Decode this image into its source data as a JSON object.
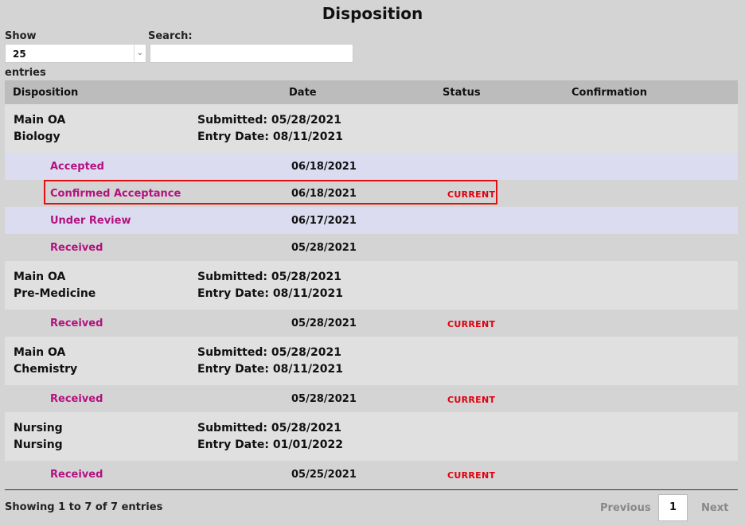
{
  "page": {
    "title": "Disposition"
  },
  "controls": {
    "show_label": "Show",
    "page_size": "25",
    "entries_label": "entries",
    "search_label": "Search:",
    "search_value": ""
  },
  "table": {
    "columns": [
      "Disposition",
      "Date",
      "Status",
      "Confirmation"
    ],
    "groups": [
      {
        "line1": "Main OA",
        "line2": "Biology",
        "submitted": "Submitted: 05/28/2021",
        "entry_date": "Entry Date: 08/11/2021",
        "rows": [
          {
            "name": "Accepted",
            "date": "06/18/2021",
            "status": ""
          },
          {
            "name": "Confirmed Acceptance",
            "date": "06/18/2021",
            "status": "CURRENT"
          },
          {
            "name": "Under Review",
            "date": "06/17/2021",
            "status": ""
          },
          {
            "name": "Received",
            "date": "05/28/2021",
            "status": ""
          }
        ]
      },
      {
        "line1": "Main OA",
        "line2": "Pre-Medicine",
        "submitted": "Submitted: 05/28/2021",
        "entry_date": "Entry Date: 08/11/2021",
        "rows": [
          {
            "name": "Received",
            "date": "05/28/2021",
            "status": "CURRENT"
          }
        ]
      },
      {
        "line1": "Main OA",
        "line2": "Chemistry",
        "submitted": "Submitted: 05/28/2021",
        "entry_date": "Entry Date: 08/11/2021",
        "rows": [
          {
            "name": "Received",
            "date": "05/28/2021",
            "status": "CURRENT"
          }
        ]
      },
      {
        "line1": "Nursing",
        "line2": "Nursing",
        "submitted": "Submitted: 05/28/2021",
        "entry_date": "Entry Date: 01/01/2022",
        "rows": [
          {
            "name": "Received",
            "date": "05/25/2021",
            "status": "CURRENT"
          }
        ]
      }
    ]
  },
  "footer": {
    "info": "Showing 1 to 7 of 7 entries",
    "previous": "Previous",
    "current_page": "1",
    "next": "Next"
  },
  "colors": {
    "status_name": "#b3127f",
    "current_status": "#e0000f",
    "highlight_border": "#e01010",
    "header_bg": "#bcbcbc",
    "group_bg": "#e0e0e0",
    "alt_row_bg": "#dcdcf1"
  },
  "icons": {
    "select_arrow": "chevron-down-icon"
  }
}
